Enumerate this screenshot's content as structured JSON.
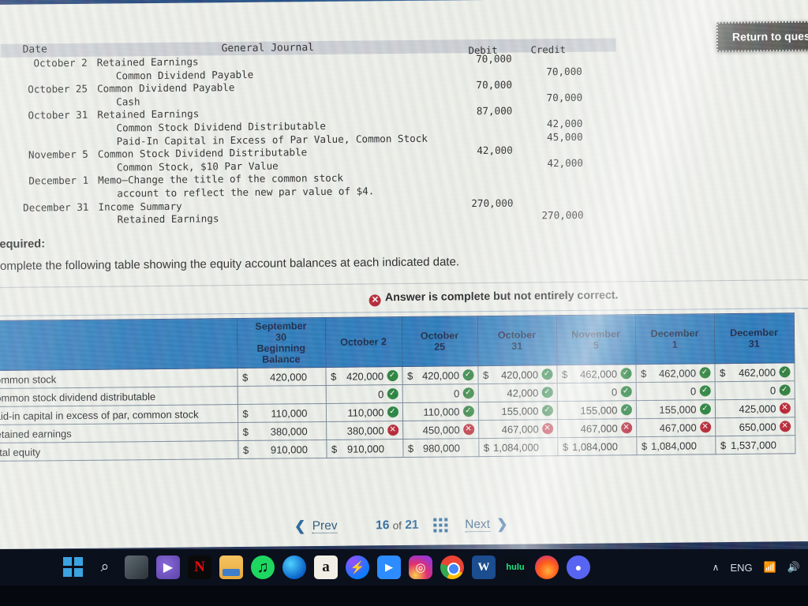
{
  "window": {
    "return_button": "Return to question"
  },
  "journal": {
    "headers": {
      "date": "Date",
      "general_journal": "General Journal",
      "debit": "Debit",
      "credit": "Credit"
    },
    "rows": [
      {
        "date": "October 2",
        "account": "Retained Earnings",
        "indent": 0,
        "debit": "70,000",
        "credit": ""
      },
      {
        "date": "",
        "account": "Common Dividend Payable",
        "indent": 1,
        "debit": "",
        "credit": "70,000"
      },
      {
        "date": "October 25",
        "account": "Common Dividend Payable",
        "indent": 0,
        "debit": "70,000",
        "credit": ""
      },
      {
        "date": "",
        "account": "Cash",
        "indent": 1,
        "debit": "",
        "credit": "70,000"
      },
      {
        "date": "October 31",
        "account": "Retained Earnings",
        "indent": 0,
        "debit": "87,000",
        "credit": ""
      },
      {
        "date": "",
        "account": "Common Stock Dividend Distributable",
        "indent": 1,
        "debit": "",
        "credit": "42,000"
      },
      {
        "date": "",
        "account": "Paid-In Capital in Excess of Par Value, Common Stock",
        "indent": 1,
        "debit": "",
        "credit": "45,000"
      },
      {
        "date": "November 5",
        "account": "Common Stock Dividend Distributable",
        "indent": 0,
        "debit": "42,000",
        "credit": ""
      },
      {
        "date": "",
        "account": "Common Stock, $10 Par Value",
        "indent": 1,
        "debit": "",
        "credit": "42,000"
      },
      {
        "date": "December 1",
        "account": "Memo—Change the title of the common stock",
        "indent": 0,
        "debit": "",
        "credit": ""
      },
      {
        "date": "",
        "account": "account to reflect the new par value of $4.",
        "indent": 1,
        "debit": "",
        "credit": ""
      },
      {
        "date": "December 31",
        "account": "Income Summary",
        "indent": 0,
        "debit": "270,000",
        "credit": ""
      },
      {
        "date": "",
        "account": "Retained Earnings",
        "indent": 1,
        "debit": "",
        "credit": "270,000"
      }
    ]
  },
  "required": {
    "title": "Required:",
    "text": "Complete the following table showing the equity account balances at each indicated date."
  },
  "answer_status": {
    "icon": "x-circle-icon",
    "text": "Answer is complete but not entirely correct.",
    "color": "#b1172c"
  },
  "equity_table": {
    "row_label_header": "",
    "columns": [
      "September 30 Beginning Balance",
      "October 2",
      "October 25",
      "October 31",
      "November 5",
      "December 1",
      "December 31"
    ],
    "column_lines": [
      [
        "September",
        "30",
        "Beginning",
        "Balance"
      ],
      [
        "October 2"
      ],
      [
        "October",
        "25"
      ],
      [
        "October",
        "31"
      ],
      [
        "November",
        "5"
      ],
      [
        "December",
        "1"
      ],
      [
        "December",
        "31"
      ]
    ],
    "rows": [
      {
        "label": "Common stock",
        "cells": [
          {
            "dollar": "$",
            "value": "420,000",
            "mark": "none"
          },
          {
            "dollar": "$",
            "value": "420,000",
            "mark": "ok"
          },
          {
            "dollar": "$",
            "value": "420,000",
            "mark": "ok"
          },
          {
            "dollar": "$",
            "value": "420,000",
            "mark": "ok"
          },
          {
            "dollar": "$",
            "value": "462,000",
            "mark": "ok"
          },
          {
            "dollar": "$",
            "value": "462,000",
            "mark": "ok"
          },
          {
            "dollar": "$",
            "value": "462,000",
            "mark": "ok"
          }
        ]
      },
      {
        "label": "Common stock dividend distributable",
        "cells": [
          {
            "dollar": "",
            "value": "",
            "mark": "none"
          },
          {
            "dollar": "",
            "value": "0",
            "mark": "ok"
          },
          {
            "dollar": "",
            "value": "0",
            "mark": "ok"
          },
          {
            "dollar": "",
            "value": "42,000",
            "mark": "ok"
          },
          {
            "dollar": "",
            "value": "0",
            "mark": "ok"
          },
          {
            "dollar": "",
            "value": "0",
            "mark": "ok"
          },
          {
            "dollar": "",
            "value": "0",
            "mark": "ok"
          }
        ]
      },
      {
        "label": "Paid-in capital in excess of par, common stock",
        "cells": [
          {
            "dollar": "$",
            "value": "110,000",
            "mark": "none"
          },
          {
            "dollar": "",
            "value": "110,000",
            "mark": "ok"
          },
          {
            "dollar": "",
            "value": "110,000",
            "mark": "ok"
          },
          {
            "dollar": "",
            "value": "155,000",
            "mark": "ok"
          },
          {
            "dollar": "",
            "value": "155,000",
            "mark": "ok"
          },
          {
            "dollar": "",
            "value": "155,000",
            "mark": "ok"
          },
          {
            "dollar": "",
            "value": "425,000",
            "mark": "bad"
          }
        ]
      },
      {
        "label": "Retained earnings",
        "cells": [
          {
            "dollar": "$",
            "value": "380,000",
            "mark": "none"
          },
          {
            "dollar": "",
            "value": "380,000",
            "mark": "bad"
          },
          {
            "dollar": "",
            "value": "450,000",
            "mark": "bad"
          },
          {
            "dollar": "",
            "value": "467,000",
            "mark": "bad"
          },
          {
            "dollar": "",
            "value": "467,000",
            "mark": "bad"
          },
          {
            "dollar": "",
            "value": "467,000",
            "mark": "bad"
          },
          {
            "dollar": "",
            "value": "650,000",
            "mark": "bad"
          }
        ]
      },
      {
        "label": "Total equity",
        "total": true,
        "cells": [
          {
            "dollar": "$",
            "value": "910,000",
            "mark": "none"
          },
          {
            "dollar": "$",
            "value": "910,000",
            "mark": "none"
          },
          {
            "dollar": "$",
            "value": "980,000",
            "mark": "none"
          },
          {
            "dollar": "$",
            "value": "1,084,000",
            "mark": "none"
          },
          {
            "dollar": "$",
            "value": "1,084,000",
            "mark": "none"
          },
          {
            "dollar": "$",
            "value": "1,084,000",
            "mark": "none"
          },
          {
            "dollar": "$",
            "value": "1,537,000",
            "mark": "none"
          }
        ]
      }
    ]
  },
  "pager": {
    "prev": "Prev",
    "current": "16",
    "of": "of",
    "total": "21",
    "next": "Next",
    "grid_icon": "grid-icon",
    "prev_icon": "chevron-left-icon",
    "next_icon": "chevron-right-icon"
  },
  "taskbar": {
    "icons": [
      {
        "name": "windows-start-icon",
        "label": ""
      },
      {
        "name": "search-icon",
        "label": "⌕"
      },
      {
        "name": "task-view-icon",
        "label": ""
      },
      {
        "name": "teams-icon",
        "label": "▶"
      },
      {
        "name": "netflix-icon",
        "label": "N"
      },
      {
        "name": "file-explorer-icon",
        "label": ""
      },
      {
        "name": "spotify-icon",
        "label": "♫"
      },
      {
        "name": "microsoft-edge-icon",
        "label": ""
      },
      {
        "name": "amazon-icon",
        "label": "a"
      },
      {
        "name": "messenger-icon",
        "label": "⚡"
      },
      {
        "name": "zoom-icon",
        "label": "▶"
      },
      {
        "name": "instagram-icon",
        "label": "◎"
      },
      {
        "name": "google-chrome-icon",
        "label": ""
      },
      {
        "name": "microsoft-word-icon",
        "label": "W"
      },
      {
        "name": "hulu-icon",
        "label": "hulu"
      },
      {
        "name": "firefox-icon",
        "label": ""
      },
      {
        "name": "discord-icon",
        "label": "●"
      }
    ],
    "tray": {
      "chevron": "∧",
      "language": "ENG",
      "wifi": "◠",
      "volume": "◁)"
    }
  },
  "colors": {
    "table_header_bg": "#2273b8",
    "correct_green": "#1d7a34",
    "incorrect_red": "#b5182c",
    "link_blue": "#1f4e79",
    "taskbar_bg": "#0b101d"
  }
}
